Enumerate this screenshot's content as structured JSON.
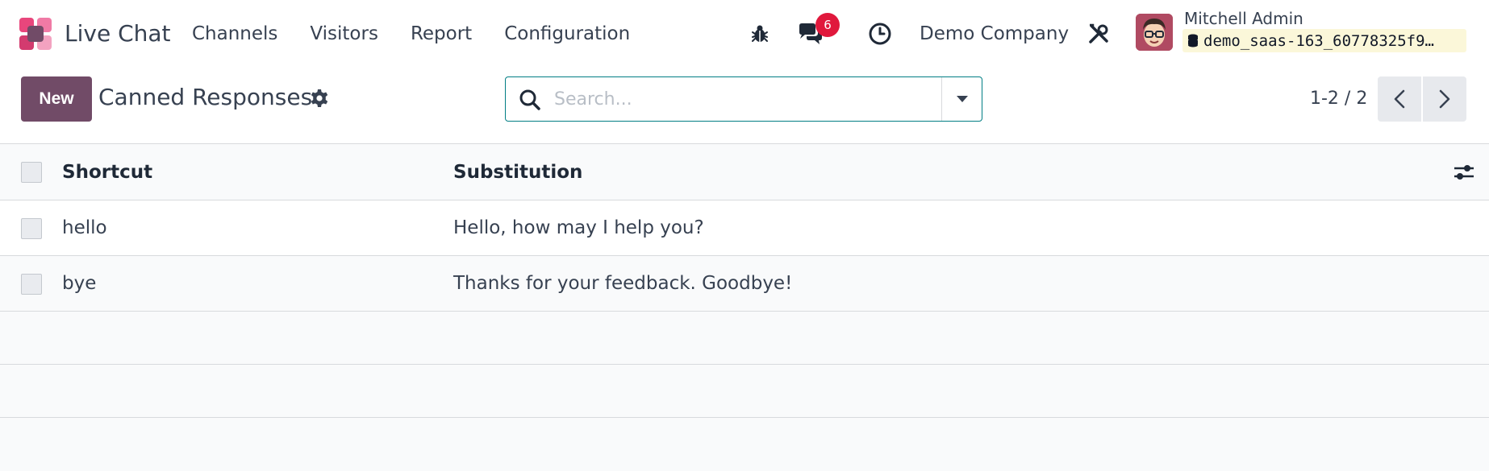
{
  "navbar": {
    "app_name": "Live Chat",
    "menu": [
      "Channels",
      "Visitors",
      "Report",
      "Configuration"
    ],
    "message_count": "6",
    "company": "Demo Company",
    "user_name": "Mitchell Admin",
    "database": "demo_saas-163_60778325f9…",
    "icons": [
      "bug-icon",
      "chat-icon",
      "clock-icon",
      "tools-icon",
      "database-icon"
    ]
  },
  "control": {
    "new_label": "New",
    "title": "Canned Responses",
    "search_placeholder": "Search...",
    "pager": "1-2 / 2"
  },
  "list": {
    "columns": [
      "Shortcut",
      "Substitution"
    ],
    "rows": [
      {
        "shortcut": "hello",
        "substitution": "Hello, how may I help you?"
      },
      {
        "shortcut": "bye",
        "substitution": "Thanks for your feedback. Goodbye!"
      }
    ]
  },
  "colors": {
    "brand": "#714b67",
    "accent": "#017e84",
    "badge": "#e0183c"
  }
}
